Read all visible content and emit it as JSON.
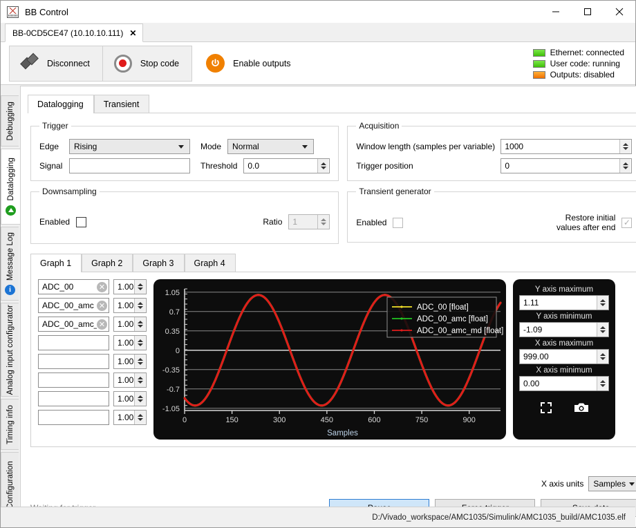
{
  "window": {
    "title": "BB Control",
    "minimize": "–",
    "maximize": "□",
    "close": "✕"
  },
  "connection_tabs": [
    {
      "label": "BB-0CD5CE47 (10.10.10.111)",
      "close": "✕"
    }
  ],
  "toolbar": {
    "disconnect": "Disconnect",
    "stop_code": "Stop code",
    "enable_outputs": "Enable outputs"
  },
  "status": {
    "items": [
      {
        "label": "Ethernet: connected",
        "color": "#3fbf08"
      },
      {
        "label": "User code: running",
        "color": "#3fbf08"
      },
      {
        "label": "Outputs: disabled",
        "color": "#f07000"
      }
    ]
  },
  "sidebar": {
    "items": [
      {
        "label": "Debugging",
        "icon": "",
        "active": false
      },
      {
        "label": "Datalogging",
        "icon": "green-up-arrow-icon",
        "active": true
      },
      {
        "label": "Message Log",
        "icon": "blue-info-icon",
        "active": false
      },
      {
        "label": "Analog input configurator",
        "icon": "",
        "active": false
      },
      {
        "label": "Timing info",
        "icon": "",
        "active": false
      },
      {
        "label": "Configuration",
        "icon": "",
        "active": false
      }
    ]
  },
  "main_tabs": [
    {
      "label": "Datalogging",
      "active": true
    },
    {
      "label": "Transient",
      "active": false
    }
  ],
  "trigger": {
    "legend": "Trigger",
    "edge_label": "Edge",
    "edge_value": "Rising",
    "mode_label": "Mode",
    "mode_value": "Normal",
    "signal_label": "Signal",
    "signal_value": "",
    "threshold_label": "Threshold",
    "threshold_value": "0.0"
  },
  "acquisition": {
    "legend": "Acquisition",
    "window_length_label": "Window length (samples per variable)",
    "window_length_value": "1000",
    "trigger_position_label": "Trigger position",
    "trigger_position_value": "0"
  },
  "downsampling": {
    "legend": "Downsampling",
    "enabled_label": "Enabled",
    "enabled_checked": false,
    "ratio_label": "Ratio",
    "ratio_value": "1",
    "ratio_disabled": true
  },
  "transient_generator": {
    "legend": "Transient generator",
    "enabled_label": "Enabled",
    "enabled_checked": false,
    "restore_label_line1": "Restore initial",
    "restore_label_line2": "values after end",
    "restore_checked": true
  },
  "graph_tabs": [
    {
      "label": "Graph 1",
      "active": true
    },
    {
      "label": "Graph 2",
      "active": false
    },
    {
      "label": "Graph 3",
      "active": false
    },
    {
      "label": "Graph 4",
      "active": false
    }
  ],
  "variables": [
    {
      "name": "ADC_00",
      "scale": "1.00",
      "has_clear": true
    },
    {
      "name": "ADC_00_amc",
      "scale": "1.00",
      "has_clear": true
    },
    {
      "name": "ADC_00_amc_md",
      "scale": "1.00",
      "has_clear": true
    },
    {
      "name": "",
      "scale": "1.00",
      "has_clear": false
    },
    {
      "name": "",
      "scale": "1.00",
      "has_clear": false
    },
    {
      "name": "",
      "scale": "1.00",
      "has_clear": false
    },
    {
      "name": "",
      "scale": "1.00",
      "has_clear": false
    },
    {
      "name": "",
      "scale": "1.00",
      "has_clear": false
    }
  ],
  "axis_controls": {
    "y_max_label": "Y axis maximum",
    "y_max_value": "1.11",
    "y_min_label": "Y axis minimum",
    "y_min_value": "-1.09",
    "x_max_label": "X axis maximum",
    "x_max_value": "999.00",
    "x_min_label": "X axis minimum",
    "x_min_value": "0.00",
    "fullscreen_icon": "fullscreen-icon",
    "camera_icon": "camera-icon"
  },
  "footer": {
    "x_axis_units_label": "X axis units",
    "x_axis_units_value": "Samples",
    "status_text": "Waiting for trigger...",
    "pause": "Pause",
    "force_trigger": "Force trigger",
    "save_data": "Save data",
    "path": "D:/Vivado_workspace/AMC1035/Simulink/AMC1035_build/AMC1035.elf"
  },
  "chart_data": {
    "type": "line",
    "title": "",
    "xlabel": "Samples",
    "ylabel": "",
    "xlim": [
      0,
      999
    ],
    "ylim": [
      -1.09,
      1.11
    ],
    "xticks": [
      0,
      150,
      300,
      450,
      600,
      750,
      900
    ],
    "yticks": [
      1.05,
      0.7,
      0.35,
      0,
      -0.35,
      -0.7,
      -1.05
    ],
    "grid": true,
    "background": "#0d0d0d",
    "legend_position": "top-right",
    "series": [
      {
        "name": "ADC_00 [float]",
        "color": "#f2e029",
        "waveform": "sine",
        "amplitude": 1.0,
        "period_samples": 400,
        "phase_deg": -120,
        "offset": 0.0
      },
      {
        "name": "ADC_00_amc [float]",
        "color": "#22c422",
        "waveform": "sine",
        "amplitude": 1.0,
        "period_samples": 400,
        "phase_deg": -120,
        "offset": 0.0
      },
      {
        "name": "ADC_00_amc_md [float]",
        "color": "#e01b1b",
        "waveform": "sine",
        "amplitude": 1.0,
        "period_samples": 400,
        "phase_deg": -120,
        "offset": 0.0
      }
    ]
  }
}
